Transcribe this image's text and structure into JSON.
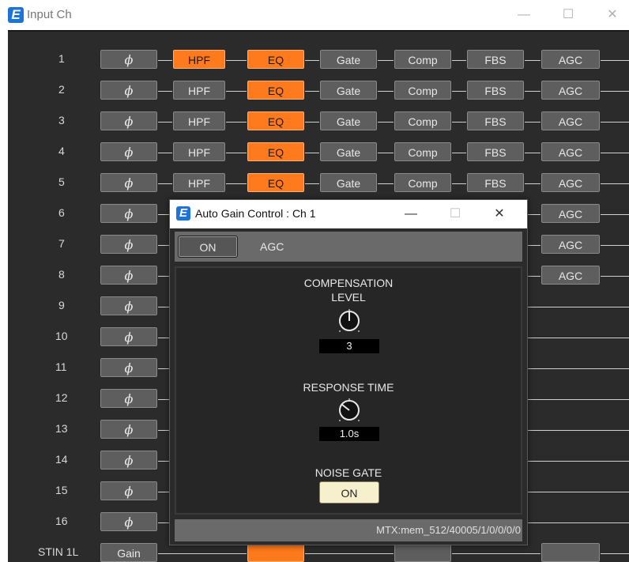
{
  "window": {
    "title": "Input Ch",
    "minimize_glyph": "—",
    "maximize_glyph": "☐",
    "close_glyph": "✕"
  },
  "colors": {
    "active_orange": "#ff7a1c",
    "button_gray": "#5e5e5e",
    "background": "#2b2b2b",
    "noise_gate_on": "#f7f0cc"
  },
  "icons": {
    "app": "yamaha-editor-logo-icon",
    "phase": "phase-invert-icon",
    "knob": "rotary-knob-icon"
  },
  "app_logo_glyph": "E",
  "rows": [
    {
      "num": "1",
      "phase": "ϕ",
      "hpf": "HPF",
      "hpf_on": true,
      "eq": "EQ",
      "eq_on": true,
      "gate": "Gate",
      "comp": "Comp",
      "fbs": "FBS",
      "agc": "AGC"
    },
    {
      "num": "2",
      "phase": "ϕ",
      "hpf": "HPF",
      "hpf_on": false,
      "eq": "EQ",
      "eq_on": true,
      "gate": "Gate",
      "comp": "Comp",
      "fbs": "FBS",
      "agc": "AGC"
    },
    {
      "num": "3",
      "phase": "ϕ",
      "hpf": "HPF",
      "hpf_on": false,
      "eq": "EQ",
      "eq_on": true,
      "gate": "Gate",
      "comp": "Comp",
      "fbs": "FBS",
      "agc": "AGC"
    },
    {
      "num": "4",
      "phase": "ϕ",
      "hpf": "HPF",
      "hpf_on": false,
      "eq": "EQ",
      "eq_on": true,
      "gate": "Gate",
      "comp": "Comp",
      "fbs": "FBS",
      "agc": "AGC"
    },
    {
      "num": "5",
      "phase": "ϕ",
      "hpf": "HPF",
      "hpf_on": false,
      "eq": "EQ",
      "eq_on": true,
      "gate": "Gate",
      "comp": "Comp",
      "fbs": "FBS",
      "agc": "AGC"
    },
    {
      "num": "6",
      "phase": "ϕ",
      "agc": "AGC"
    },
    {
      "num": "7",
      "phase": "ϕ",
      "agc": "AGC"
    },
    {
      "num": "8",
      "phase": "ϕ",
      "agc": "AGC"
    },
    {
      "num": "9",
      "phase": "ϕ"
    },
    {
      "num": "10",
      "phase": "ϕ"
    },
    {
      "num": "11",
      "phase": "ϕ"
    },
    {
      "num": "12",
      "phase": "ϕ"
    },
    {
      "num": "13",
      "phase": "ϕ"
    },
    {
      "num": "14",
      "phase": "ϕ"
    },
    {
      "num": "15",
      "phase": "ϕ"
    },
    {
      "num": "16",
      "phase": "ϕ"
    },
    {
      "num": "STIN 1L",
      "gain": "Gain"
    }
  ],
  "dialog": {
    "title": "Auto Gain Control : Ch 1",
    "on_button": "ON",
    "agc_label": "AGC",
    "compensation_title_1": "COMPENSATION",
    "compensation_title_2": "LEVEL",
    "compensation_value": "3",
    "response_title": "RESPONSE TIME",
    "response_value": "1.0s",
    "noise_gate_title": "NOISE GATE",
    "noise_gate_button": "ON",
    "status": "MTX:mem_512/40005/1/0/0/0/0"
  }
}
